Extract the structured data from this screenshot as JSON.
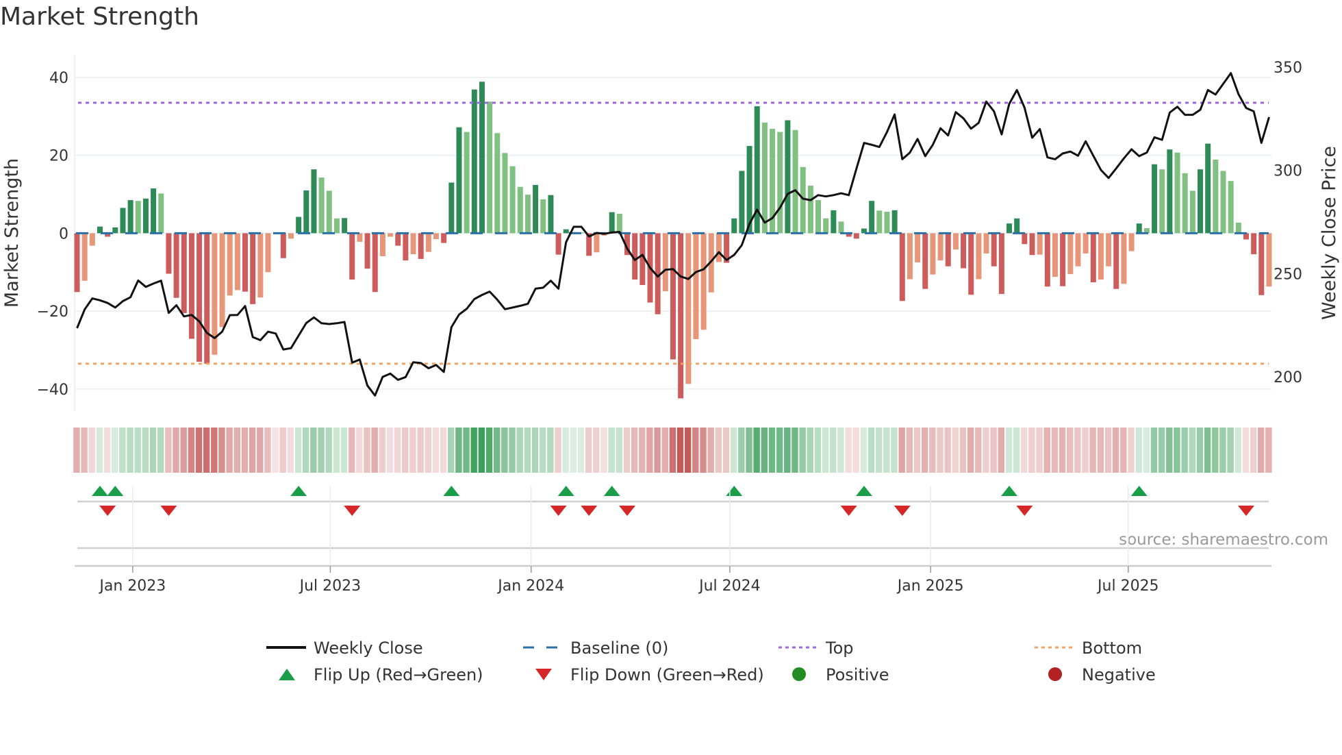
{
  "title": "Market Strength",
  "source": "source: sharemaestro.com",
  "colors": {
    "bar_pos_rising": "#2e8b57",
    "bar_pos_falling": "#80c080",
    "bar_neg_falling": "#cd5c5c",
    "bar_neg_rising": "#e8967a",
    "price": "#111111",
    "baseline": "#2a6fa8",
    "top": "#a066e0",
    "bottom": "#f4a460",
    "flip_up": "#1a9e4a",
    "flip_down": "#d62728",
    "positive": "#228b22",
    "negative": "#b22222"
  },
  "legend": [
    {
      "label": "Weekly Close",
      "symbol": "line"
    },
    {
      "label": "Baseline (0)",
      "symbol": "dash"
    },
    {
      "label": "Top",
      "symbol": "dot-top"
    },
    {
      "label": "Bottom",
      "symbol": "dot-bottom"
    },
    {
      "label": "Flip Up (Red→Green)",
      "symbol": "tri-up"
    },
    {
      "label": "Flip Down (Green→Red)",
      "symbol": "tri-down"
    },
    {
      "label": "Positive",
      "symbol": "circle-pos"
    },
    {
      "label": "Negative",
      "symbol": "circle-neg"
    }
  ],
  "chart_data": {
    "type": "bar",
    "title": "Market Strength",
    "ylabel": "Market Strength",
    "y2label": "Weekly Close Price",
    "ylim": [
      -45,
      45
    ],
    "y2_ticks": [
      "200",
      "250",
      "300",
      "350"
    ],
    "y2_tick_values": [
      200,
      250,
      300,
      350
    ],
    "y_ticks": [
      "−40",
      "−20",
      "0",
      "20",
      "40"
    ],
    "y_tick_values": [
      -40,
      -20,
      0,
      20,
      40
    ],
    "top_level": 33.5,
    "bottom_level": -33.5,
    "baseline": 0,
    "x_start": "2022-11-11",
    "x_step_days": 7,
    "x_ticks": [
      {
        "label": "Jan 2023",
        "date": "2023-01-01"
      },
      {
        "label": "Jul 2023",
        "date": "2023-07-01"
      },
      {
        "label": "Jan 2024",
        "date": "2024-01-01"
      },
      {
        "label": "Jul 2024",
        "date": "2024-07-01"
      },
      {
        "label": "Jan 2025",
        "date": "2025-01-01"
      },
      {
        "label": "Jul 2025",
        "date": "2025-07-01"
      }
    ],
    "strength": [
      -15.1,
      -12.2,
      -3.2,
      1.7,
      -0.9,
      1.5,
      6.5,
      8.5,
      8.3,
      8.9,
      11.5,
      10.2,
      -10.4,
      -16.6,
      -20.5,
      -27.1,
      -33,
      -33.5,
      -31.2,
      -24.1,
      -16,
      -14.6,
      -15,
      -18.2,
      -16.5,
      -10,
      -0.2,
      -6.4,
      -1.4,
      4.2,
      11,
      16.4,
      14.3,
      10.9,
      3.8,
      3.9,
      -11.9,
      -2.2,
      -9.1,
      -15.1,
      -5.9,
      -0.9,
      -3.2,
      -7,
      -5.4,
      -6.6,
      -4.8,
      -1.5,
      -2.5,
      13,
      27.2,
      26,
      36.9,
      38.9,
      33.8,
      25.7,
      20.6,
      17.2,
      11.9,
      9.9,
      12.4,
      8.7,
      9.8,
      -5.5,
      1,
      0.3,
      0.2,
      -5.8,
      -4.9,
      -0.6,
      5.4,
      5,
      -5.6,
      -11.9,
      -13.3,
      -17.8,
      -20.8,
      -14.9,
      -32.4,
      -42.4,
      -38.7,
      -27.2,
      -24.8,
      -15.2,
      -7.4,
      -7.6,
      3.8,
      16,
      22.4,
      32.6,
      28.4,
      26.8,
      26,
      29,
      26.5,
      17,
      12.2,
      8.5,
      3.8,
      5.9,
      3,
      -0.9,
      -1.4,
      1.2,
      8.3,
      5.8,
      5.5,
      5.9,
      -17.4,
      -11.8,
      -7.5,
      -14.3,
      -10.6,
      -7,
      -8.5,
      -4.2,
      -9,
      -15.8,
      -11.8,
      -5.2,
      -8.5,
      -15.6,
      2.5,
      3.8,
      -2.8,
      -5.6,
      -5.5,
      -13.7,
      -11.2,
      -13.6,
      -10.5,
      -8.5,
      -5.2,
      -12.6,
      -11.9,
      -8.5,
      -14.3,
      -13,
      -4.6,
      2.5,
      1.3,
      17.7,
      16.4,
      21.5,
      20.7,
      15.4,
      10.9,
      16.4,
      23,
      18.9,
      16,
      13.4,
      2.7,
      -1.6,
      -5.4,
      -15.9,
      -13.7
    ],
    "weekly_close": [
      223.6,
      232.7,
      238,
      237.1,
      235.8,
      233.6,
      236.7,
      238.6,
      246.7,
      243.6,
      245.2,
      246.6,
      231,
      234.7,
      229.3,
      230,
      226.9,
      221.3,
      218.8,
      221.9,
      229.9,
      230,
      234.3,
      219.3,
      217.8,
      221.9,
      221,
      213.3,
      213.9,
      220,
      226.1,
      228.8,
      226,
      225.6,
      226,
      226.6,
      206.9,
      208.4,
      195.8,
      191,
      200,
      201.6,
      198.6,
      199.9,
      207.1,
      206.7,
      204.2,
      205.8,
      202.4,
      224.1,
      230.2,
      233,
      237.7,
      239.7,
      241.3,
      237.4,
      232.8,
      233.6,
      234.4,
      235.4,
      242.7,
      243.2,
      246.6,
      242.7,
      265.2,
      272.7,
      272.7,
      268,
      269.7,
      269.3,
      269.9,
      270.2,
      262.1,
      256.6,
      259.1,
      252.8,
      248.6,
      251.9,
      252.2,
      248.6,
      247.4,
      250.8,
      252.1,
      256,
      260.4,
      256.6,
      259.1,
      263.8,
      274.1,
      281,
      274.7,
      276.9,
      281.9,
      288.6,
      290.4,
      286.3,
      285.6,
      288,
      287.4,
      288,
      288.9,
      288,
      300.8,
      313.3,
      312.4,
      311.3,
      318.6,
      327.1,
      305.4,
      308.6,
      315.2,
      306.9,
      312.4,
      320.4,
      316.9,
      328.2,
      325.2,
      320.2,
      323,
      333.3,
      328.6,
      317.4,
      332.2,
      338.9,
      330.4,
      315.8,
      320,
      306.3,
      305.4,
      308.2,
      309.1,
      307.1,
      314.1,
      307.1,
      300.2,
      296.3,
      301,
      305.8,
      310.2,
      306.9,
      308.6,
      316,
      314.8,
      328,
      330.8,
      326.9,
      326.9,
      329.3,
      338.9,
      336.7,
      341.9,
      347.1,
      336.9,
      330.2,
      328.6,
      313.3,
      325.8
    ]
  }
}
